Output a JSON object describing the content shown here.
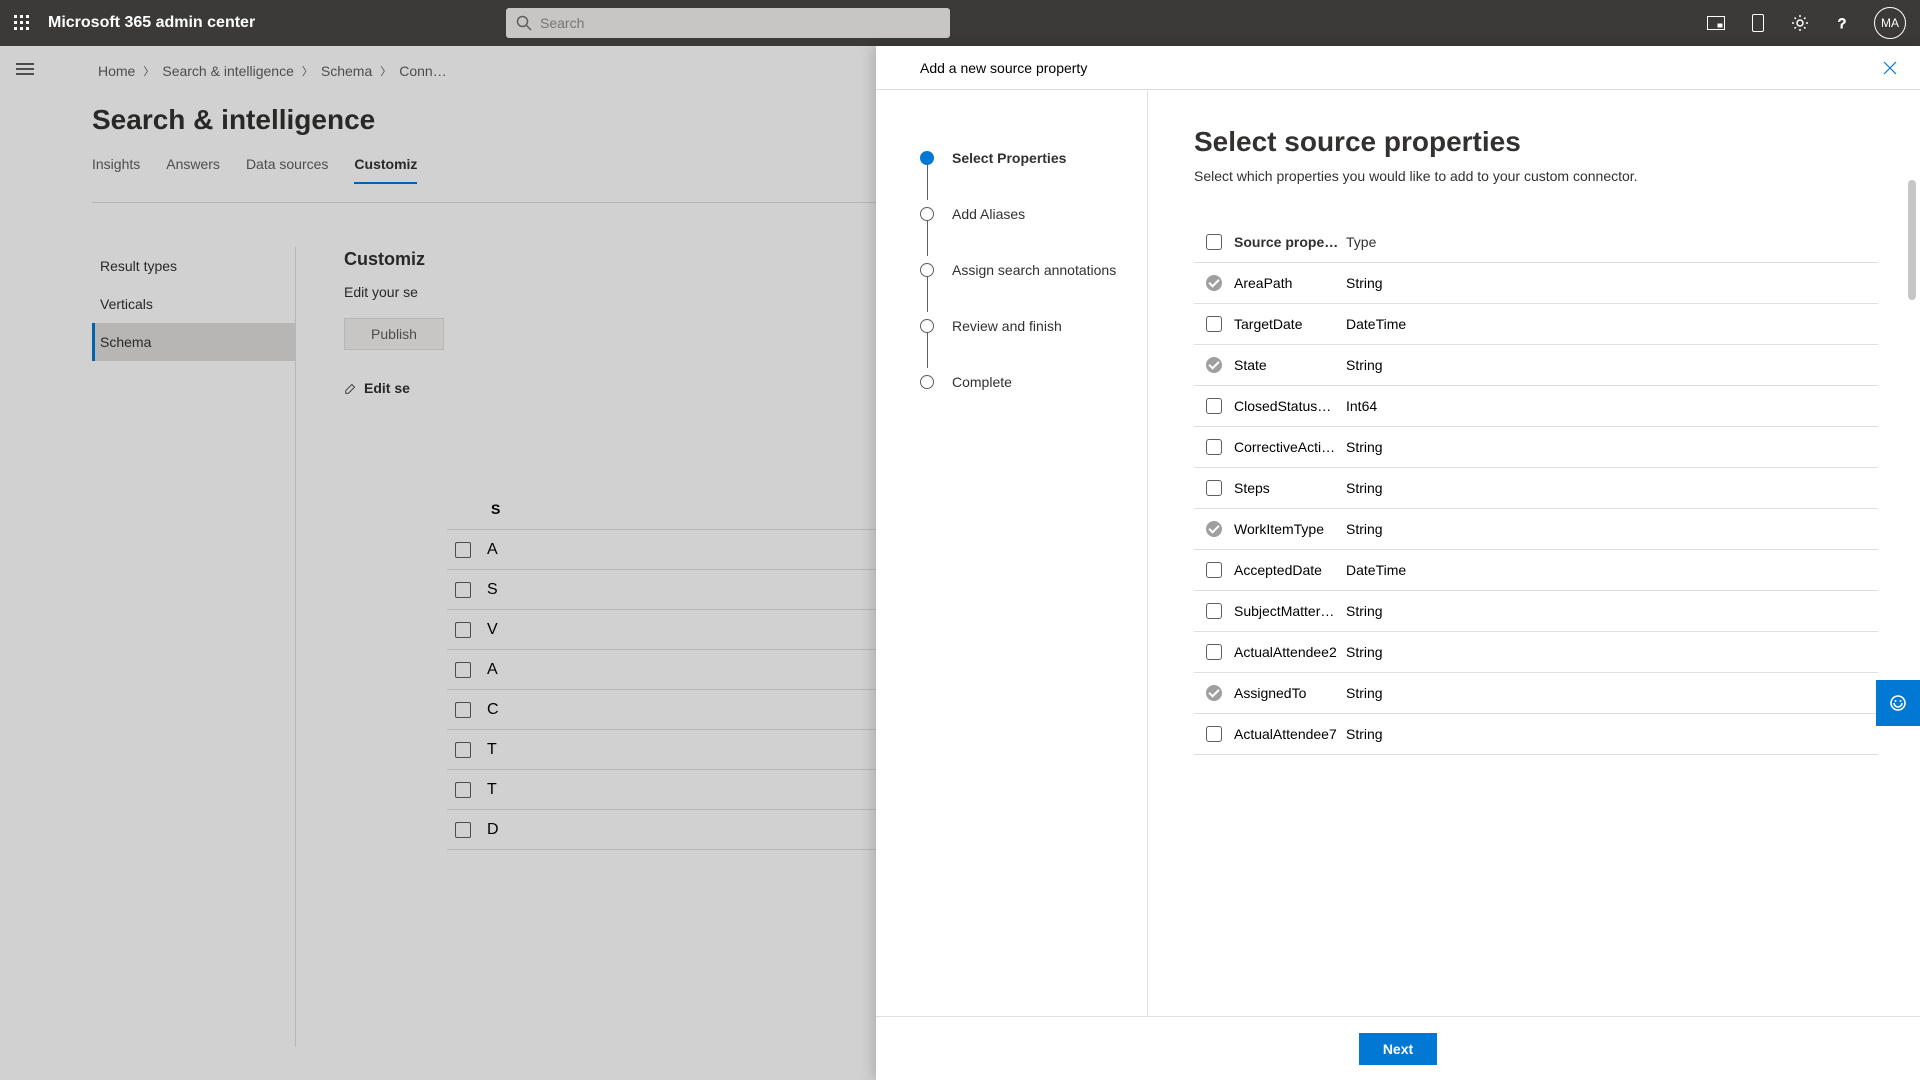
{
  "header": {
    "title": "Microsoft 365 admin center",
    "search_placeholder": "Search",
    "avatar_initials": "MA"
  },
  "breadcrumb": [
    "Home",
    "Search & intelligence",
    "Schema",
    "Conn…"
  ],
  "page_title": "Search & intelligence",
  "tabs": [
    "Insights",
    "Answers",
    "Data sources",
    "Customiz"
  ],
  "active_tab": 3,
  "side_nav": [
    "Result types",
    "Verticals",
    "Schema"
  ],
  "side_nav_selected": 2,
  "body": {
    "section_title": "Customiz",
    "desc": "Edit your se",
    "publish_label": "Publish",
    "edit_link_label": "Edit se",
    "back_table_header": "S",
    "back_rows": [
      "A",
      "S",
      "V",
      "A",
      "C",
      "T",
      "T",
      "D"
    ]
  },
  "panel": {
    "title": "Add a new source property",
    "steps": [
      "Select Properties",
      "Add Aliases",
      "Assign search annotations",
      "Review and finish",
      "Complete"
    ],
    "active_step": 0,
    "main_title": "Select source properties",
    "main_sub": "Select which properties you would like to add to your custom connector.",
    "columns": {
      "name": "Source property",
      "type": "Type"
    },
    "rows": [
      {
        "name": "AreaPath",
        "type": "String",
        "checked": true
      },
      {
        "name": "TargetDate",
        "type": "DateTime",
        "checked": false
      },
      {
        "name": "State",
        "type": "String",
        "checked": true
      },
      {
        "name": "ClosedStatusCode",
        "type": "Int64",
        "checked": false
      },
      {
        "name": "CorrectiveAction…",
        "type": "String",
        "checked": false
      },
      {
        "name": "Steps",
        "type": "String",
        "checked": false
      },
      {
        "name": "WorkItemType",
        "type": "String",
        "checked": true
      },
      {
        "name": "AcceptedDate",
        "type": "DateTime",
        "checked": false
      },
      {
        "name": "SubjectMatterEx…",
        "type": "String",
        "checked": false
      },
      {
        "name": "ActualAttendee2",
        "type": "String",
        "checked": false
      },
      {
        "name": "AssignedTo",
        "type": "String",
        "checked": true
      },
      {
        "name": "ActualAttendee7",
        "type": "String",
        "checked": false
      }
    ],
    "next_label": "Next"
  },
  "colors": {
    "accent": "#0078d4"
  }
}
